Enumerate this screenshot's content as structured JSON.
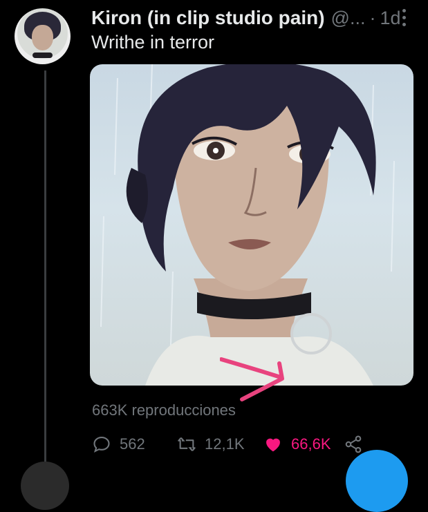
{
  "tweet": {
    "author_name": "Kiron (in clip studio pain)",
    "handle": "@...",
    "separator": "·",
    "time": "1d",
    "text": "Writhe in terror",
    "views": "663K reproducciones",
    "media_icon": "portrait-illustration",
    "annotation_icon": "pink-arrow-icon"
  },
  "actions": {
    "reply_count": "562",
    "retweet_count": "12,1K",
    "like_count": "66,6K",
    "liked": true
  },
  "icons": [
    "more-vertical-icon",
    "reply-icon",
    "retweet-icon",
    "heart-icon",
    "share-icon"
  ],
  "colors": {
    "background": "#000000",
    "text_primary": "#e7e9ea",
    "text_secondary": "#71767b",
    "like_pink": "#f91880",
    "annotation_pink": "#e8437e",
    "fab_blue": "#1d9bf0"
  }
}
